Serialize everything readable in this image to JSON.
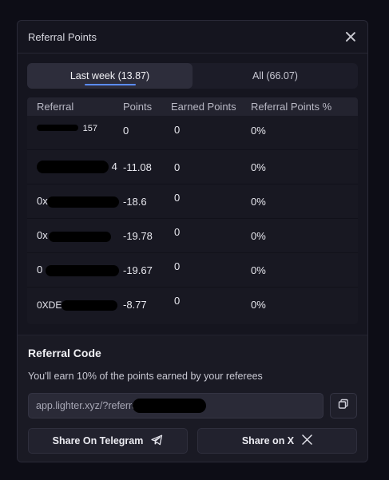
{
  "modal": {
    "title": "Referral Points"
  },
  "tabs": [
    {
      "label": "Last week (13.87)",
      "active": true
    },
    {
      "label": "All (66.07)",
      "active": false
    }
  ],
  "table": {
    "headers": [
      "Referral",
      "Points",
      "Earned Points",
      "Referral Points %"
    ],
    "rows": [
      {
        "referral": "157",
        "points": "0",
        "earned": "0",
        "pct": "0%"
      },
      {
        "referral": "4",
        "points": "-11.08",
        "earned": "0",
        "pct": "0%"
      },
      {
        "referral": "0x",
        "points": "-18.6",
        "earned": "0",
        "pct": "0%"
      },
      {
        "referral": "0x",
        "points": "-19.78",
        "earned": "0",
        "pct": "0%"
      },
      {
        "referral": "0",
        "points": "-19.67",
        "earned": "0",
        "pct": "0%"
      },
      {
        "referral": "0XDE",
        "points": "-8.77",
        "earned": "0",
        "pct": "0%"
      }
    ]
  },
  "referral_code": {
    "title": "Referral Code",
    "description": "You'll earn 10% of the points earned by your referees",
    "link": "app.lighter.xyz/?referra"
  },
  "share": {
    "telegram_label": "Share On Telegram",
    "x_label": "Share on X"
  },
  "icons": {
    "close": "close-icon",
    "copy": "copy-icon",
    "telegram": "telegram-icon",
    "x": "x-logo-icon"
  },
  "colors": {
    "accent": "#5b8cff",
    "background": "#15151f"
  }
}
